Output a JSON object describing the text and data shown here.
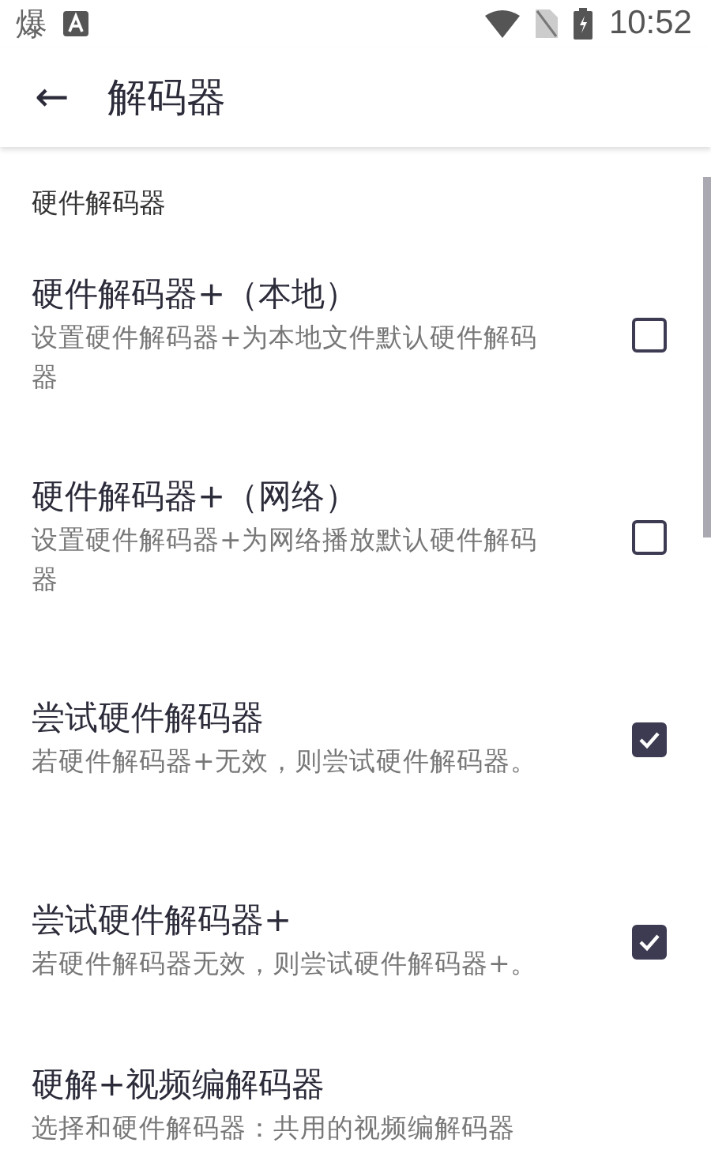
{
  "status_bar": {
    "notification_text": "爆",
    "time": "10:52"
  },
  "toolbar": {
    "back_icon": "←",
    "title": "解码器"
  },
  "section": {
    "title": "硬件解码器"
  },
  "settings": [
    {
      "title": "硬件解码器+（本地）",
      "summary": "设置硬件解码器+为本地文件默认硬件解码器",
      "kind": "checkbox",
      "checked": false
    },
    {
      "title": "硬件解码器+（网络）",
      "summary": "设置硬件解码器+为网络播放默认硬件解码器",
      "kind": "checkbox",
      "checked": false
    },
    {
      "title": "尝试硬件解码器",
      "summary": "若硬件解码器+无效，则尝试硬件解码器。",
      "kind": "checkbox",
      "checked": true
    },
    {
      "title": "尝试硬件解码器+",
      "summary": "若硬件解码器无效，则尝试硬件解码器+。",
      "kind": "checkbox",
      "checked": true
    },
    {
      "title": "硬解+视频编解码器",
      "summary": "选择和硬件解码器：共用的视频编解码器",
      "kind": "plain"
    }
  ]
}
